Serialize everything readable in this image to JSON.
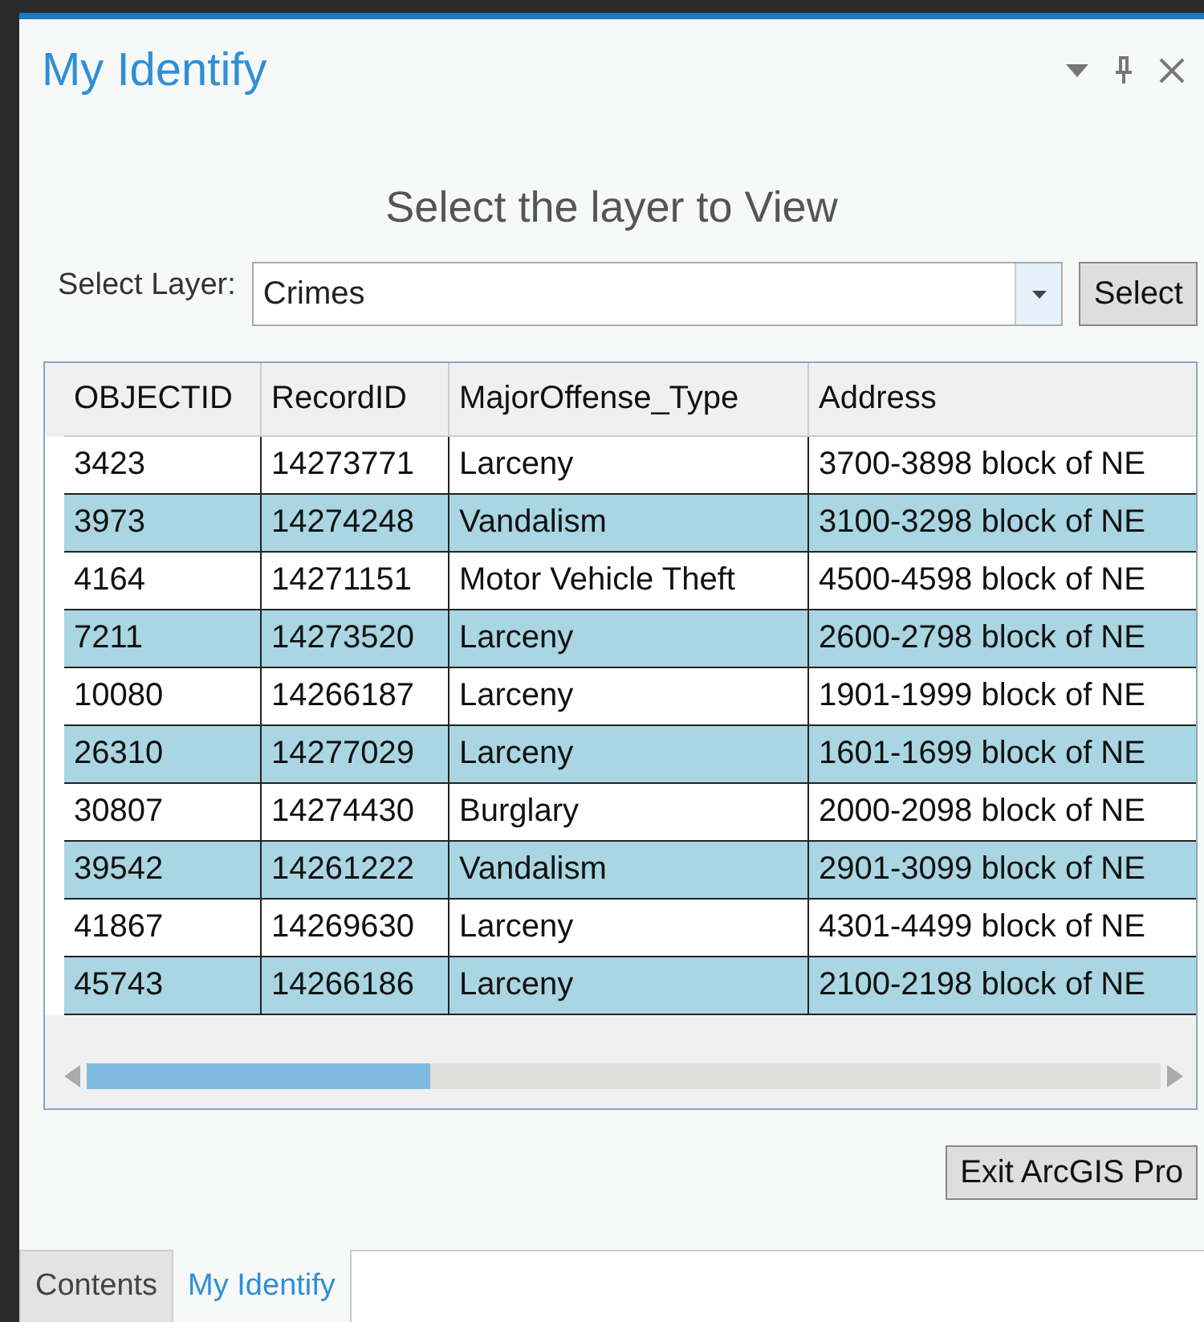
{
  "pane": {
    "title": "My Identify"
  },
  "heading": "Select the layer to View",
  "layer_select": {
    "label": "Select Layer:",
    "value": "Crimes",
    "button": "Select"
  },
  "table": {
    "columns": [
      "OBJECTID",
      "RecordID",
      "MajorOffense_Type",
      "Address"
    ],
    "rows": [
      [
        "3423",
        "14273771",
        "Larceny",
        "3700-3898 block of NE"
      ],
      [
        "3973",
        "14274248",
        "Vandalism",
        "3100-3298 block of NE"
      ],
      [
        "4164",
        "14271151",
        "Motor Vehicle Theft",
        "4500-4598 block of NE"
      ],
      [
        "7211",
        "14273520",
        "Larceny",
        "2600-2798 block of NE"
      ],
      [
        "10080",
        "14266187",
        "Larceny",
        "1901-1999 block of NE"
      ],
      [
        "26310",
        "14277029",
        "Larceny",
        "1601-1699 block of NE"
      ],
      [
        "30807",
        "14274430",
        "Burglary",
        "2000-2098 block of NE"
      ],
      [
        "39542",
        "14261222",
        "Vandalism",
        "2901-3099 block of NE"
      ],
      [
        "41867",
        "14269630",
        "Larceny",
        "4301-4499 block of NE"
      ],
      [
        "45743",
        "14266186",
        "Larceny",
        "2100-2198 block of NE"
      ]
    ]
  },
  "exit_button": "Exit ArcGIS Pro",
  "tabs": [
    {
      "label": "Contents",
      "selected": false
    },
    {
      "label": "My Identify",
      "selected": true
    }
  ]
}
